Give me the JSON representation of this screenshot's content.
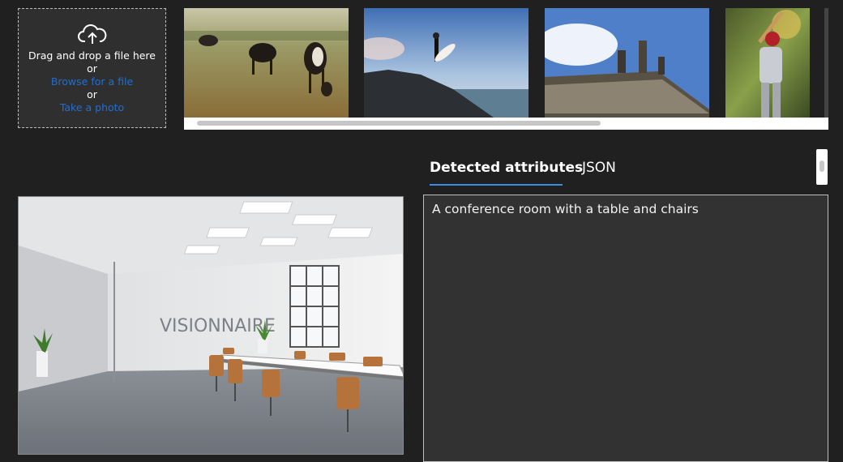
{
  "upload": {
    "line1": "Drag and drop a file here",
    "or1": "or",
    "browse_link": "Browse for a file",
    "or2": "or",
    "photo_link": "Take a photo",
    "icon": "cloud-upload-icon"
  },
  "thumbnails": [
    {
      "subject": "cows grazing in field"
    },
    {
      "subject": "surfer on rocks"
    },
    {
      "subject": "building statues"
    },
    {
      "subject": "baseball batter"
    }
  ],
  "tabs": [
    {
      "label": "Detected attributes",
      "active": true
    },
    {
      "label": "JSON",
      "active": false
    }
  ],
  "result": {
    "caption": "A conference room with a table and chairs"
  },
  "main_image": {
    "logo_text": "VISIONNAIRE"
  },
  "colors": {
    "accent": "#3a8de0",
    "link": "#1f6fd1",
    "background": "#202020",
    "panel": "#323232"
  }
}
